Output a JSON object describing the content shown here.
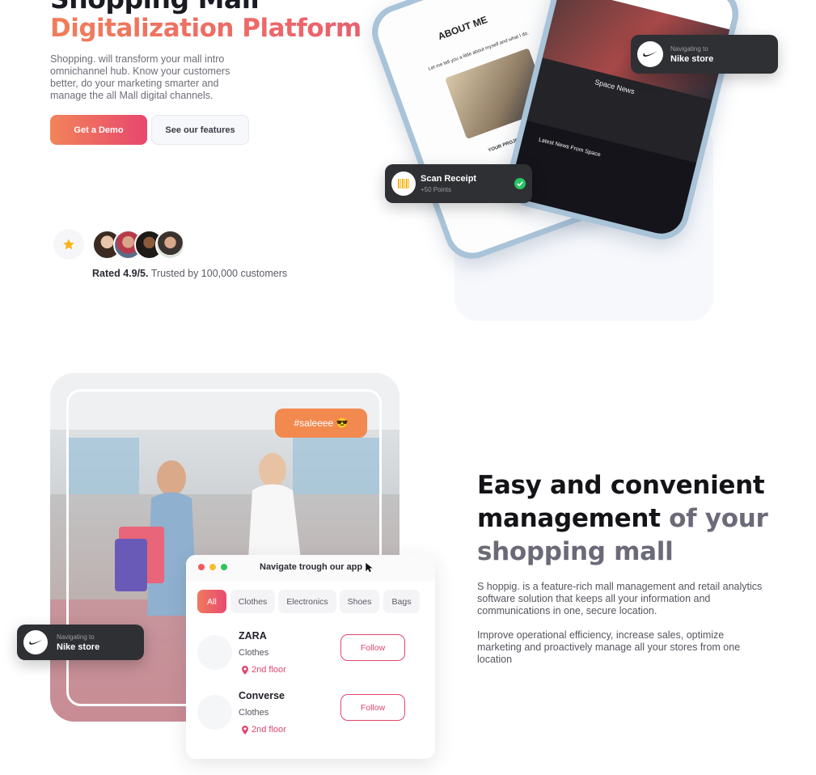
{
  "hero": {
    "title_line1": "Shopping Mall",
    "title_line2": "Digitalization Platform",
    "description": "Shopping. will transform your mall intro omnichannel hub. Know your customers better, do your marketing smarter and manage the all Mall digital channels.",
    "demo_button": "Get a Demo",
    "features_button": "See our features",
    "rating_bold": "Rated 4.9/5.",
    "rating_rest": " Trusted by 100,000 customers",
    "avatar_count": 4
  },
  "phones": {
    "back_title": "ABOUT ME",
    "back_subtitle": "Let me tell you a little about myself and what I do.",
    "back_section": "YOUR PROJECT",
    "front_news_title": "Space News",
    "front_latest": "Latest News From Space"
  },
  "badges": {
    "nike_top": {
      "small": "Navigating to",
      "big": "Nike store"
    },
    "scan": {
      "big": "Scan Receipt",
      "small": "+50 Points"
    },
    "nike_left": {
      "small": "Navigating to",
      "big": "Nike store"
    }
  },
  "section2": {
    "sale_tag": "#saleeee 😎",
    "app_title": "Navigate trough our app",
    "chips": [
      "All",
      "Clothes",
      "Electronics",
      "Shoes",
      "Bags"
    ],
    "stores": [
      {
        "name": "ZARA",
        "category": "Clothes",
        "floor": "2nd floor",
        "action": "Follow"
      },
      {
        "name": "Converse",
        "category": "Clothes",
        "floor": "2nd floor",
        "action": "Follow"
      }
    ],
    "title_dark": "Easy and convenient management",
    "title_muted": " of your shopping mall",
    "desc1": "S hoppig. is a feature-rich mall management and retail analytics software solution that keeps all your information and communications in one, secure location.",
    "desc2": "Improve operational efficiency, increase sales, optimize marketing and proactively manage all your stores from one location"
  },
  "colors": {
    "accent_start": "#f2845a",
    "accent_end": "#e8476e",
    "sale_orange": "#f2894f",
    "check_green": "#27c464",
    "dark_pill": "#2f3034"
  }
}
